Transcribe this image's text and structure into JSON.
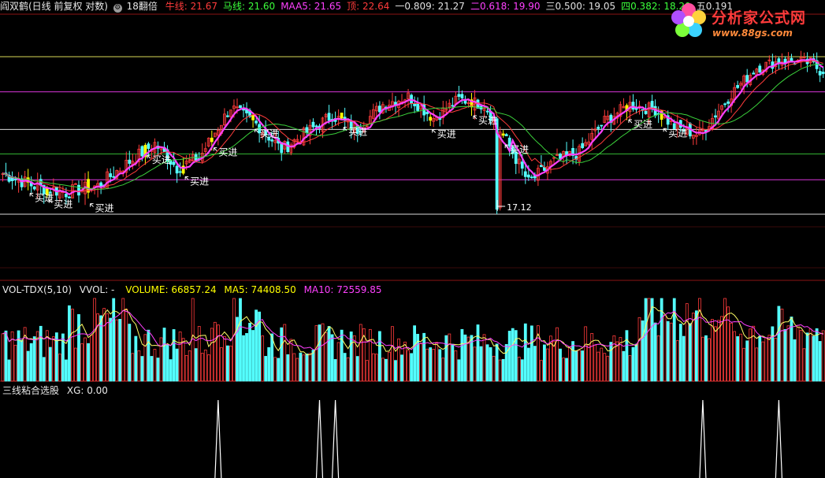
{
  "main_panel": {
    "title": "阎双鹤(日线 前复权 对数)",
    "indicator_name": "18翻倍",
    "items": [
      {
        "label": "牛线:",
        "value": "21.67",
        "color": "#ff3b3b"
      },
      {
        "label": "马线:",
        "value": "21.60",
        "color": "#3bff3b"
      },
      {
        "label": "MAA5:",
        "value": "21.65",
        "color": "#ff40ff"
      },
      {
        "label": "顶:",
        "value": "22.64",
        "color": "#ff3b3b"
      },
      {
        "label": "一0.809:",
        "value": "21.27",
        "color": "#e0e0e0"
      },
      {
        "label": "二0.618:",
        "value": "19.90",
        "color": "#ff40ff"
      },
      {
        "label": "三0.500:",
        "value": "19.05",
        "color": "#e0e0e0"
      },
      {
        "label": "四0.382:",
        "value": "18.20",
        "color": "#3bff3b"
      },
      {
        "label": "五0.191",
        "value": "",
        "color": "#e0e0e0"
      }
    ],
    "signal_label": "买进",
    "low_label": "17.12"
  },
  "volume_panel": {
    "title": "VOL-TDX(5,10)",
    "vvol": "VVOL: -",
    "volume": "VOLUME: 66857.24",
    "ma5": "MA5: 74408.50",
    "ma10": "MA10: 72559.85"
  },
  "signal_panel": {
    "title": "三线粘合选股",
    "xg": "XG: 0.00"
  },
  "logo": {
    "text": "分析家公式网",
    "url": "www.88gs.com"
  },
  "colors": {
    "up": "#ff3b3b",
    "down": "#54ffff",
    "yellow_bar": "#ffff00",
    "ma_magenta": "#ff40ff",
    "ma_green": "#3bd23b",
    "ma_red": "#ff3b3b",
    "grid_red": "#8b1414"
  },
  "fib_lines": [
    {
      "name": "顶",
      "price": 22.64,
      "color": "#ffff66"
    },
    {
      "name": "0.809",
      "price": 21.27,
      "color": "#ff40ff"
    },
    {
      "name": "0.618",
      "price": 19.9,
      "color": "#ffffff"
    },
    {
      "name": "0.500",
      "price": 19.05,
      "color": "#3bd23b"
    },
    {
      "name": "0.382",
      "price": 18.2,
      "color": "#ff40ff"
    },
    {
      "name": "0.191",
      "price": 17.12,
      "color": "#ffffff"
    }
  ],
  "chart_data": {
    "type": "candlestick",
    "anchors": [
      [
        0,
        18.4
      ],
      [
        10,
        18.0
      ],
      [
        20,
        17.8
      ],
      [
        30,
        18.0
      ],
      [
        40,
        18.8
      ],
      [
        48,
        19.4
      ],
      [
        55,
        18.6
      ],
      [
        62,
        18.9
      ],
      [
        72,
        20.7
      ],
      [
        80,
        20.1
      ],
      [
        88,
        19.2
      ],
      [
        96,
        19.8
      ],
      [
        104,
        20.4
      ],
      [
        112,
        19.9
      ],
      [
        120,
        20.8
      ],
      [
        128,
        21.1
      ],
      [
        136,
        20.3
      ],
      [
        144,
        21.0
      ],
      [
        152,
        20.8
      ],
      [
        160,
        19.3
      ],
      [
        166,
        18.1
      ],
      [
        174,
        18.8
      ],
      [
        182,
        19.1
      ],
      [
        190,
        20.2
      ],
      [
        198,
        20.8
      ],
      [
        206,
        20.6
      ],
      [
        212,
        20.0
      ],
      [
        220,
        19.7
      ],
      [
        230,
        21.2
      ],
      [
        238,
        22.2
      ],
      [
        246,
        22.5
      ],
      [
        255,
        22.4
      ],
      [
        258,
        22.1
      ]
    ],
    "buy_signals": [
      8,
      14,
      27,
      45,
      57,
      66,
      79,
      107,
      135,
      148,
      158,
      197,
      208
    ],
    "low_index": 156,
    "low_value": 17.12,
    "xg_spikes": [
      68,
      100,
      105,
      221,
      245
    ]
  }
}
